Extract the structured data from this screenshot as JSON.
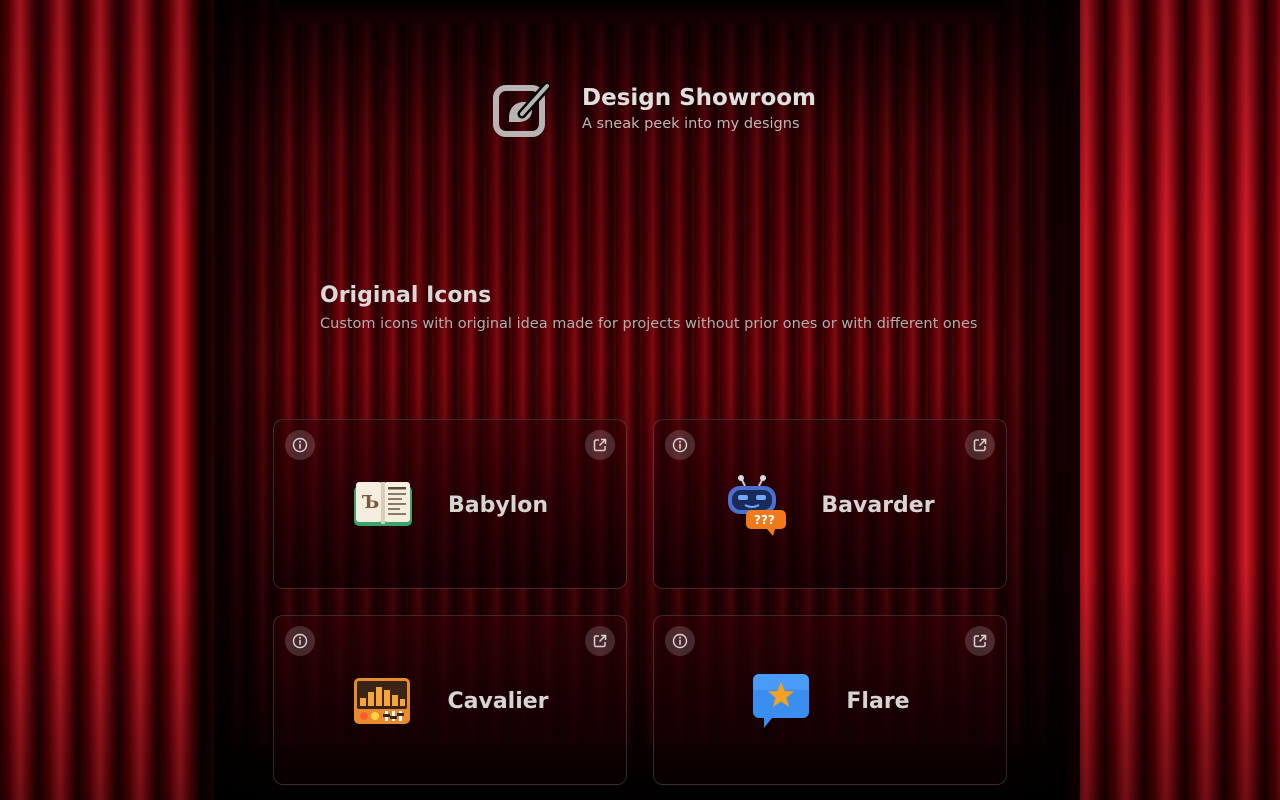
{
  "header": {
    "title": "Design Showroom",
    "subtitle": "A sneak peek into my designs",
    "logo_icon": "edit-square-icon"
  },
  "section": {
    "title": "Original Icons",
    "subtitle": "Custom icons with original idea made for projects without prior ones or with different ones"
  },
  "cards": [
    {
      "label": "Babylon",
      "icon": "book-icon"
    },
    {
      "label": "Bavarder",
      "icon": "chat-robot-icon"
    },
    {
      "label": "Cavalier",
      "icon": "audio-visualizer-icon"
    },
    {
      "label": "Flare",
      "icon": "star-chat-bubble-icon"
    }
  ],
  "colors": {
    "curtain": "#b3121d",
    "text": "#e0dede",
    "card_border": "#3a2a2a"
  }
}
